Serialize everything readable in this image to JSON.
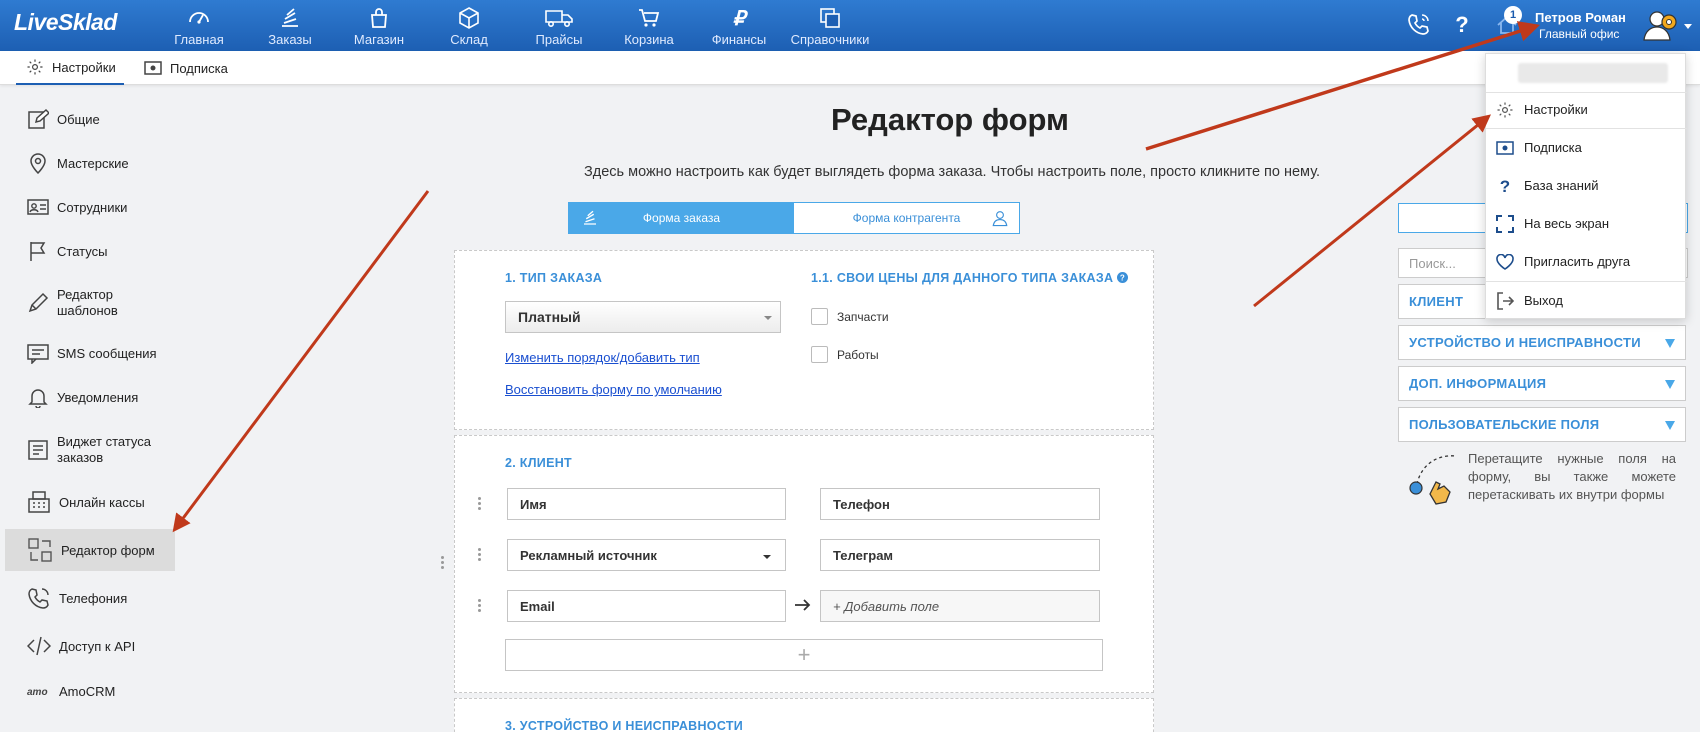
{
  "app": {
    "logo": "LiveSklad"
  },
  "nav": [
    {
      "id": "home",
      "label": "Главная",
      "icon": "dashboard-icon"
    },
    {
      "id": "orders",
      "label": "Заказы",
      "icon": "orders-icon"
    },
    {
      "id": "shop",
      "label": "Магазин",
      "icon": "shop-bag-icon"
    },
    {
      "id": "warehouse",
      "label": "Склад",
      "icon": "box-icon"
    },
    {
      "id": "prices",
      "label": "Прайсы",
      "icon": "truck-icon"
    },
    {
      "id": "cart",
      "label": "Корзина",
      "icon": "cart-icon"
    },
    {
      "id": "finance",
      "label": "Финансы",
      "icon": "ruble-icon"
    },
    {
      "id": "refs",
      "label": "Справочники",
      "icon": "copy-icon"
    }
  ],
  "user": {
    "name": "Петров Роман",
    "office": "Главный офис",
    "notifications": "1"
  },
  "subnav": [
    {
      "label": "Настройки",
      "icon": "gear-icon",
      "active": true
    },
    {
      "label": "Подписка",
      "icon": "banknote-icon",
      "active": false
    }
  ],
  "sidebar": [
    {
      "label": "Общие",
      "icon": "edit-icon"
    },
    {
      "label": "Мастерские",
      "icon": "location-pin-icon"
    },
    {
      "label": "Сотрудники",
      "icon": "id-card-icon"
    },
    {
      "label": "Статусы",
      "icon": "flag-icon"
    },
    {
      "label": "Редактор",
      "label2": "шаблонов",
      "icon": "pen-icon"
    },
    {
      "label": "SMS сообщения",
      "icon": "sms-icon"
    },
    {
      "label": "Уведомления",
      "icon": "bell-icon"
    },
    {
      "label": "Виджет статуса",
      "label2": "заказов",
      "icon": "widget-icon"
    },
    {
      "label": "Онлайн кассы",
      "icon": "cash-register-icon"
    },
    {
      "label": "Редактор форм",
      "icon": "form-editor-icon",
      "active": true
    },
    {
      "label": "Телефония",
      "icon": "phone-icon"
    },
    {
      "label": "Доступ к API",
      "icon": "code-icon"
    },
    {
      "label": "AmoCRM",
      "icon": "amo-logo-icon"
    }
  ],
  "main": {
    "title": "Редактор форм",
    "description": "Здесь можно настроить как будет выглядеть форма заказа. Чтобы настроить поле, просто кликните по нему.",
    "tabs": [
      {
        "label": "Форма заказа",
        "active": true
      },
      {
        "label": "Форма контрагента",
        "active": false
      }
    ],
    "section1": {
      "title": "1. ТИП ЗАКАЗА",
      "select_value": "Платный",
      "link_change": "Изменить порядок/добавить тип",
      "link_restore": "Восстановить форму по умолчанию",
      "prices_title": "1.1. СВОИ ЦЕНЫ ДЛЯ ДАННОГО ТИПА ЗАКАЗА",
      "checkboxes": [
        {
          "label": "Запчасти",
          "checked": false
        },
        {
          "label": "Работы",
          "checked": false
        }
      ]
    },
    "section2": {
      "title": "2. КЛИЕНТ",
      "fields": [
        {
          "left": "Имя",
          "right": "Телефон"
        },
        {
          "left": "Рекламный источник",
          "right": "Телеграм"
        },
        {
          "left": "Email",
          "right": "+ Добавить поле"
        }
      ]
    },
    "section3": {
      "title": "3. УСТРОЙСТВО И НЕИСПРАВНОСТИ"
    }
  },
  "right_panel": {
    "search_placeholder": "Поиск...",
    "groups": [
      "КЛИЕНТ",
      "УСТРОЙСТВО И НЕИСПРАВНОСТИ",
      "ДОП. ИНФОРМАЦИЯ",
      "ПОЛЬЗОВАТЕЛЬСКИЕ ПОЛЯ"
    ],
    "hint": "Перетащите нужные поля на форму, вы также можете перетаскивать их внутри формы"
  },
  "user_menu": [
    {
      "label": "Настройки",
      "icon": "gear-icon"
    },
    {
      "label": "Подписка",
      "icon": "banknote-icon"
    },
    {
      "label": "База знаний",
      "icon": "question-icon"
    },
    {
      "label": "На весь экран",
      "icon": "fullscreen-icon"
    },
    {
      "label": "Пригласить друга",
      "icon": "heart-icon"
    },
    {
      "label": "Выход",
      "icon": "logout-icon"
    }
  ],
  "colors": {
    "nav_bg": "#1d5fb3",
    "accent": "#4aa8e8",
    "arrow": "#c0391b",
    "link": "#1a4fd0"
  }
}
